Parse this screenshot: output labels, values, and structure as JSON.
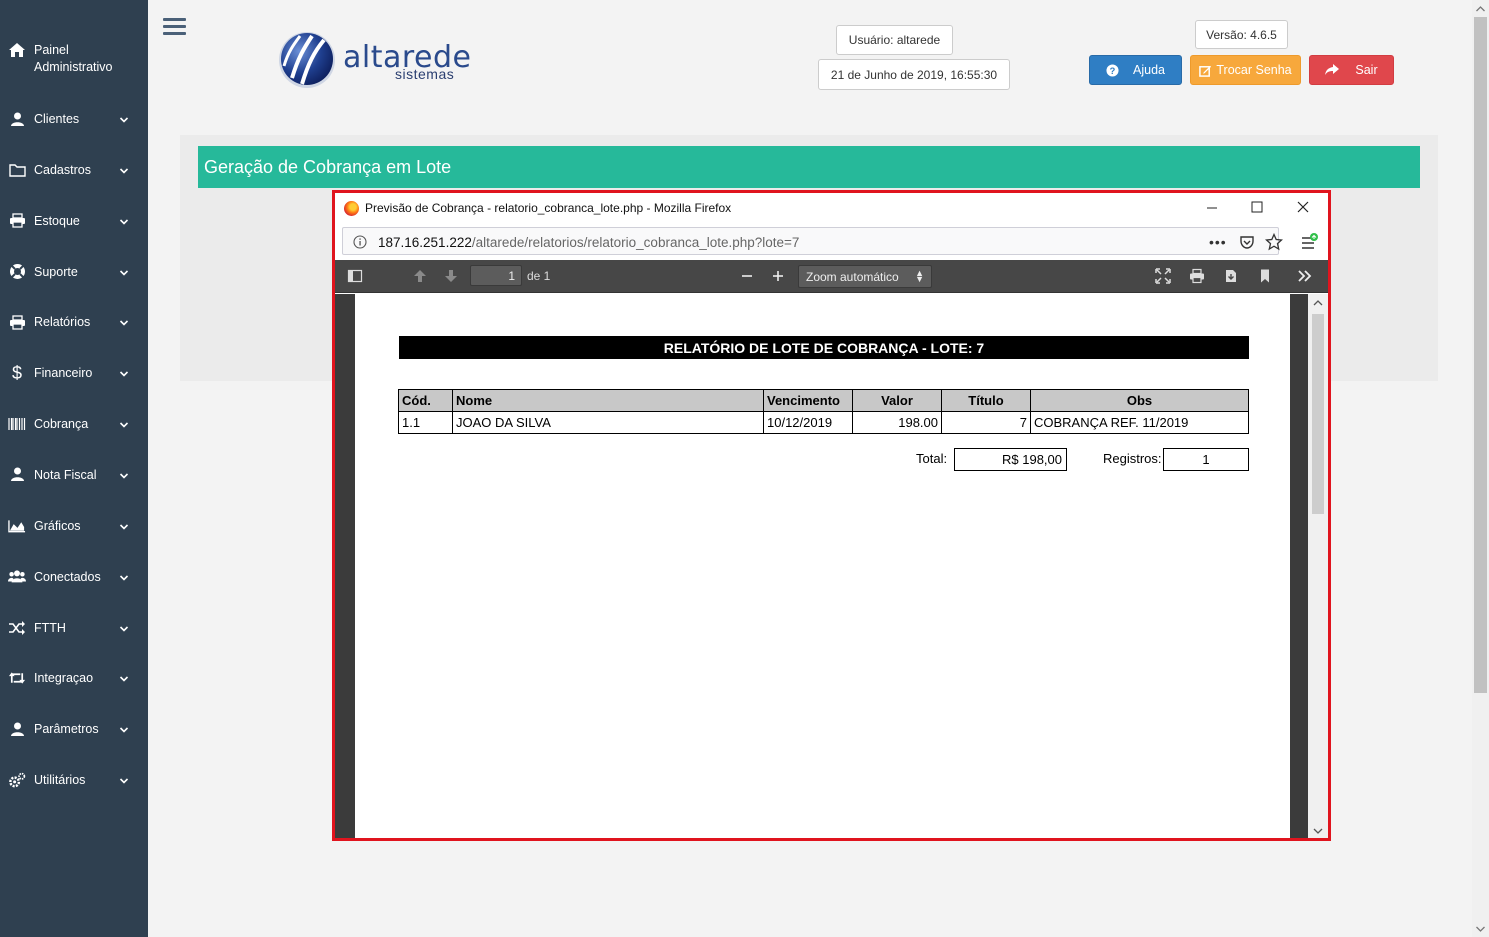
{
  "sidebar": {
    "header": "Painel Administrativo",
    "items": [
      {
        "label": "Clientes",
        "icon": "user-icon"
      },
      {
        "label": "Cadastros",
        "icon": "folder-icon"
      },
      {
        "label": "Estoque",
        "icon": "print-icon"
      },
      {
        "label": "Suporte",
        "icon": "lifebuoy-icon"
      },
      {
        "label": "Relatórios",
        "icon": "print-icon"
      },
      {
        "label": "Financeiro",
        "icon": "dollar-icon"
      },
      {
        "label": "Cobrança",
        "icon": "barcode-icon"
      },
      {
        "label": "Nota Fiscal",
        "icon": "user-icon"
      },
      {
        "label": "Gráficos",
        "icon": "area-chart-icon"
      },
      {
        "label": "Conectados",
        "icon": "users-icon"
      },
      {
        "label": "FTTH",
        "icon": "random-icon"
      },
      {
        "label": "Integraçao",
        "icon": "retweet-icon"
      },
      {
        "label": "Parâmetros",
        "icon": "user-icon"
      },
      {
        "label": "Utilitários",
        "icon": "cogs-icon"
      }
    ]
  },
  "logo": {
    "name": "altarede",
    "sub": "sistemas"
  },
  "header": {
    "user": "Usuário: altarede",
    "datetime": "21 de Junho de 2019, 16:55:30",
    "version": "Versão: 4.6.5",
    "help": "Ajuda",
    "change_password": "Trocar Senha",
    "logout": "Sair"
  },
  "panel": {
    "title": "Geração de Cobrança em Lote"
  },
  "firefox": {
    "window_title": "Previsão de Cobrança - relatorio_cobranca_lote.php - Mozilla Firefox",
    "url_host": "187.16.251.222",
    "url_path": "/altarede/relatorios/relatorio_cobranca_lote.php?lote=7",
    "page_number": "1",
    "page_of": "de 1",
    "zoom": "Zoom automático"
  },
  "report": {
    "title": "RELATÓRIO DE LOTE DE COBRANÇA - LOTE: 7",
    "columns": [
      "Cód.",
      "Nome",
      "Vencimento",
      "Valor",
      "Título",
      "Obs"
    ],
    "rows": [
      [
        "1.1",
        "JOAO DA SILVA",
        "10/12/2019",
        "198.00",
        "7",
        "COBRANÇA REF. 11/2019"
      ]
    ],
    "total_label": "Total:",
    "total_value": "R$ 198,00",
    "records_label": "Registros:",
    "records_value": "1"
  },
  "colors": {
    "sidebar": "#2f4050",
    "panel_title": "#26b99a",
    "help_btn": "#2f7ec4",
    "password_btn": "#f7a83c",
    "logout_btn": "#e0474c",
    "highlight_border": "#e0141e"
  }
}
